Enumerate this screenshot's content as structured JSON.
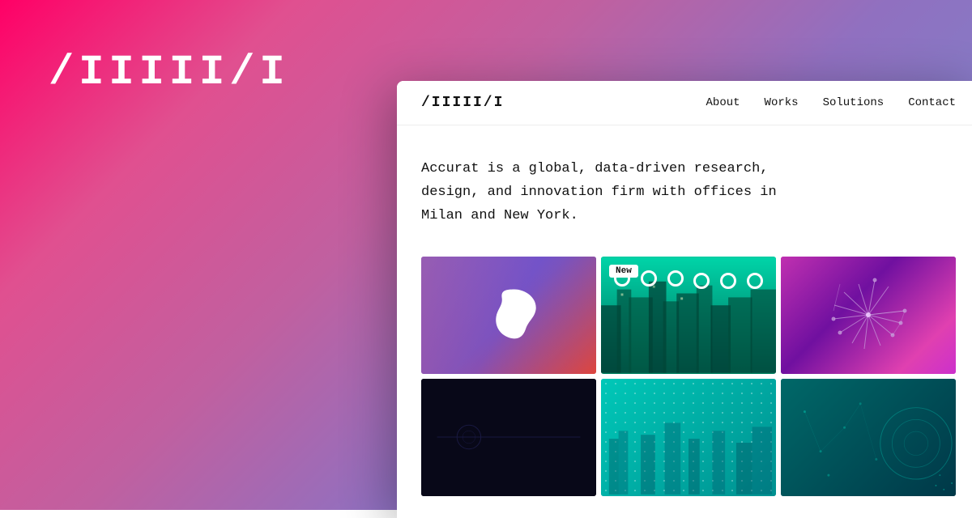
{
  "background": {
    "logo": "/IIIII/I"
  },
  "nav": {
    "logo": "/IIIII/I",
    "links": [
      {
        "label": "About",
        "name": "about"
      },
      {
        "label": "Works",
        "name": "works"
      },
      {
        "label": "Solutions",
        "name": "solutions"
      },
      {
        "label": "Contact",
        "name": "contact"
      }
    ]
  },
  "hero": {
    "text": "Accurat is a global, data-driven research, design, and innovation firm with offices in Milan and New York."
  },
  "portfolio": {
    "new_badge": "New",
    "items": [
      {
        "id": "card-1",
        "type": "blob-purple"
      },
      {
        "id": "card-2",
        "type": "teal-city"
      },
      {
        "id": "card-3",
        "type": "magenta-starburst"
      },
      {
        "id": "card-4",
        "type": "dark-minimal"
      },
      {
        "id": "card-5",
        "type": "teal-dots"
      },
      {
        "id": "card-6",
        "type": "dark-teal-circles"
      }
    ]
  }
}
